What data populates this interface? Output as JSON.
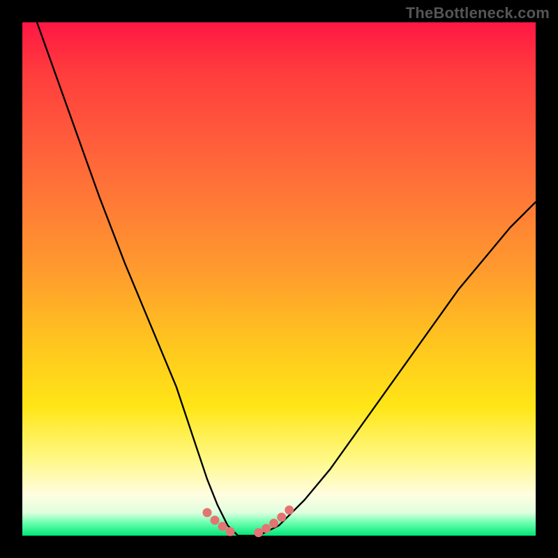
{
  "watermark": "TheBottleneck.com",
  "chart_data": {
    "type": "line",
    "title": "",
    "xlabel": "",
    "ylabel": "",
    "xlim": [
      0,
      100
    ],
    "ylim": [
      0,
      100
    ],
    "series": [
      {
        "name": "bottleneck-curve",
        "x": [
          0,
          5,
          10,
          15,
          20,
          25,
          30,
          34,
          36,
          38,
          40,
          42,
          44,
          46,
          50,
          55,
          60,
          65,
          70,
          75,
          80,
          85,
          90,
          95,
          100
        ],
        "y": [
          108,
          94,
          80,
          66,
          53,
          41,
          29,
          17,
          11,
          6,
          2,
          0,
          0,
          0,
          2,
          7,
          13,
          20,
          27,
          34,
          41,
          48,
          54,
          60,
          65
        ]
      },
      {
        "name": "valley-markers",
        "x": [
          36,
          37.5,
          39,
          40.5,
          46,
          47.5,
          49,
          50.5,
          52
        ],
        "y": [
          4.5,
          3,
          1.8,
          0.8,
          0.6,
          1.4,
          2.4,
          3.6,
          5.0
        ]
      }
    ],
    "colors": {
      "curve": "#000000",
      "markers": "#e57373"
    }
  }
}
